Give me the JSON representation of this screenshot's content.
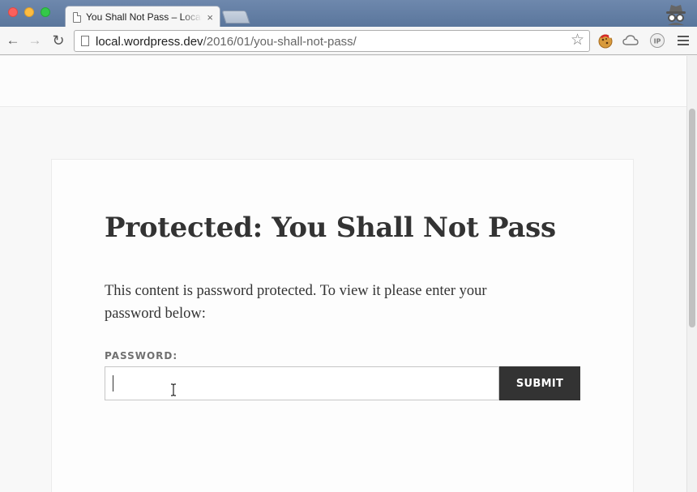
{
  "browser": {
    "tab": {
      "title": "You Shall Not Pass – Local WordPress",
      "close_glyph": "×"
    },
    "address_bar": {
      "host": "local.wordpress.dev",
      "path": "/2016/01/you-shall-not-pass/"
    },
    "icons": {
      "back": "back-arrow-icon",
      "forward": "forward-arrow-icon",
      "reload": "reload-icon",
      "bookmark": "star-icon",
      "menu": "hamburger-menu-icon",
      "incognito": "incognito-icon",
      "extensions": [
        "cookie-extension-icon",
        "cloud-extension-icon",
        "ip-extension-icon"
      ]
    }
  },
  "post": {
    "title": "Protected: You Shall Not Pass",
    "message": "This content is password protected. To view it please enter your password below:",
    "password_label": "PASSWORD:",
    "password_value": "",
    "submit_label": "SUBMIT"
  },
  "colors": {
    "button": "#333333",
    "title_text": "#333333",
    "label_text": "#707070"
  }
}
